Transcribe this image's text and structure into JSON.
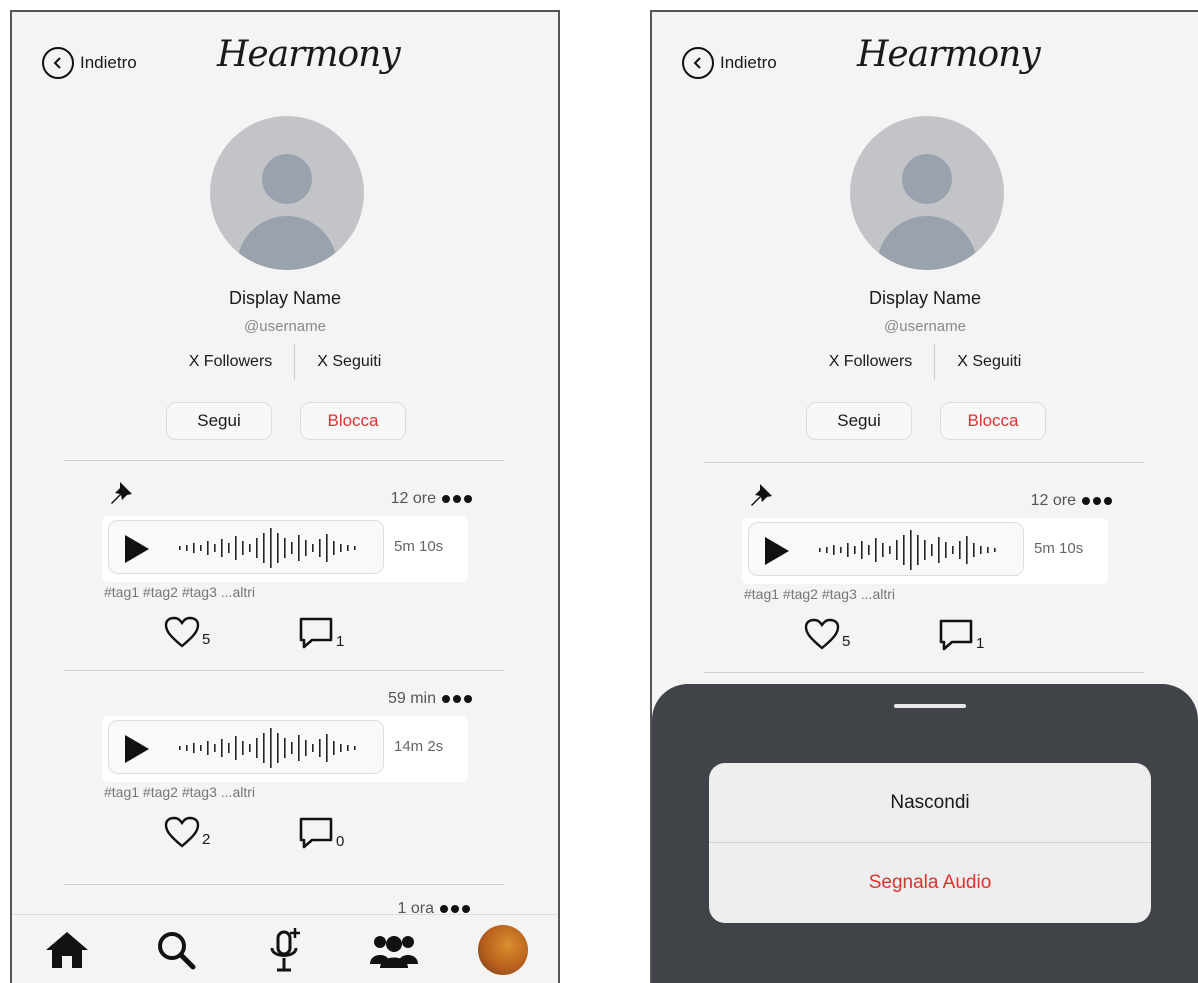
{
  "app": {
    "back_label": "Indietro",
    "logo": "Hearmony"
  },
  "profile": {
    "display_name": "Display Name",
    "username": "@username",
    "followers": "X Followers",
    "following": "X Seguiti",
    "follow_label": "Segui",
    "block_label": "Blocca"
  },
  "posts": [
    {
      "time": "12 ore",
      "duration": "5m 10s",
      "tags": "#tag1 #tag2 #tag3  ...altri",
      "likes": "5",
      "comments": "1",
      "pinned": true
    },
    {
      "time": "59 min",
      "duration": "14m 2s",
      "tags": "#tag1 #tag2 #tag3  ...altri",
      "likes": "2",
      "comments": "0",
      "pinned": false
    },
    {
      "time": "1 ora"
    }
  ],
  "nav": [
    "home-icon",
    "search-icon",
    "record-audio-icon",
    "friends-icon",
    "profile-avatar"
  ],
  "sheet": {
    "hide_label": "Nascondi",
    "report_label": "Segnala Audio"
  },
  "colors": {
    "danger": "#e0312f",
    "background": "#f4f4f4",
    "sheet": "#30343a"
  }
}
